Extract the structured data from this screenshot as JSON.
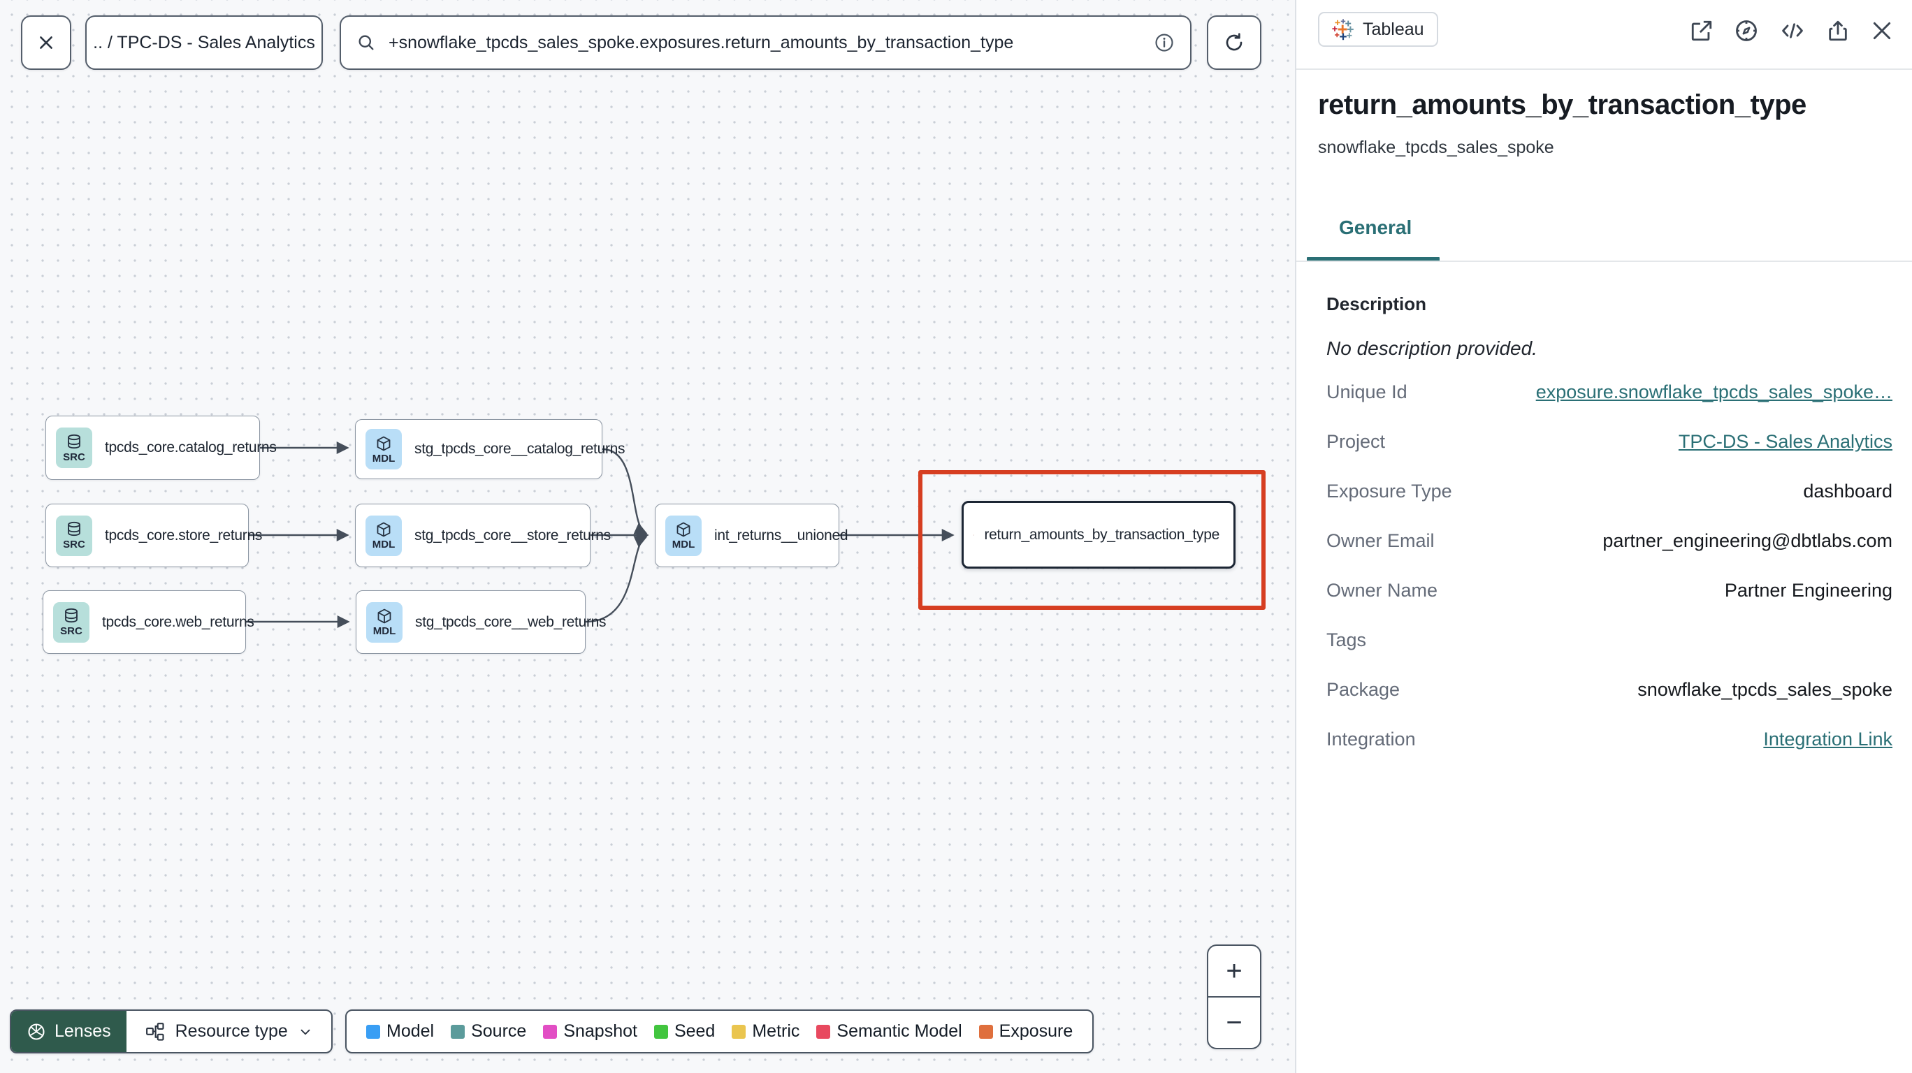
{
  "toolbar": {
    "breadcrumb": ".. / TPC-DS - Sales Analytics",
    "search_value": "+snowflake_tpcds_sales_spoke.exposures.return_amounts_by_transaction_type"
  },
  "graph": {
    "nodes": [
      {
        "type": "source",
        "badge": "SRC",
        "label": "tpcds_core.catalog_returns"
      },
      {
        "type": "source",
        "badge": "SRC",
        "label": "tpcds_core.store_returns"
      },
      {
        "type": "source",
        "badge": "SRC",
        "label": "tpcds_core.web_returns"
      },
      {
        "type": "model",
        "badge": "MDL",
        "label": "stg_tpcds_core__catalog_returns"
      },
      {
        "type": "model",
        "badge": "MDL",
        "label": "stg_tpcds_core__store_returns"
      },
      {
        "type": "model",
        "badge": "MDL",
        "label": "stg_tpcds_core__web_returns"
      },
      {
        "type": "model",
        "badge": "MDL",
        "label": "int_returns__unioned"
      },
      {
        "type": "exposure",
        "badge": "",
        "label": "return_amounts_by_transaction_type"
      }
    ],
    "lenses_label": "Lenses",
    "resource_type_label": "Resource type",
    "zoom_in_label": "+",
    "zoom_out_label": "−",
    "legend": {
      "items": [
        {
          "label": "Model",
          "color": "#399ef4"
        },
        {
          "label": "Source",
          "color": "#5b9b9b"
        },
        {
          "label": "Snapshot",
          "color": "#e24ec4"
        },
        {
          "label": "Seed",
          "color": "#42c53f"
        },
        {
          "label": "Metric",
          "color": "#eac54f"
        },
        {
          "label": "Semantic Model",
          "color": "#e8495f"
        },
        {
          "label": "Exposure",
          "color": "#df6f3d"
        }
      ]
    }
  },
  "panel": {
    "badge_label": "Tableau",
    "title": "return_amounts_by_transaction_type",
    "subtitle": "snowflake_tpcds_sales_spoke",
    "tab_label": "General",
    "description_label": "Description",
    "description_value": "No description provided.",
    "fields": [
      {
        "label": "Unique Id",
        "value": "exposure.snowflake_tpcds_sales_spoke…",
        "link": true
      },
      {
        "label": "Project",
        "value": "TPC-DS - Sales Analytics",
        "link": true
      },
      {
        "label": "Exposure Type",
        "value": "dashboard",
        "link": false
      },
      {
        "label": "Owner Email",
        "value": "partner_engineering@dbtlabs.com",
        "link": false
      },
      {
        "label": "Owner Name",
        "value": "Partner Engineering",
        "link": false
      },
      {
        "label": "Tags",
        "value": "",
        "link": false
      },
      {
        "label": "Package",
        "value": "snowflake_tpcds_sales_spoke",
        "link": false
      },
      {
        "label": "Integration",
        "value": "Integration Link",
        "link": true
      }
    ]
  },
  "colors": {
    "accent_teal": "#2a6f75",
    "selection_red": "#d63e21",
    "lenses_green": "#2f5a4c",
    "source_chip": "#b7dfdb",
    "model_chip": "#b9def7"
  }
}
